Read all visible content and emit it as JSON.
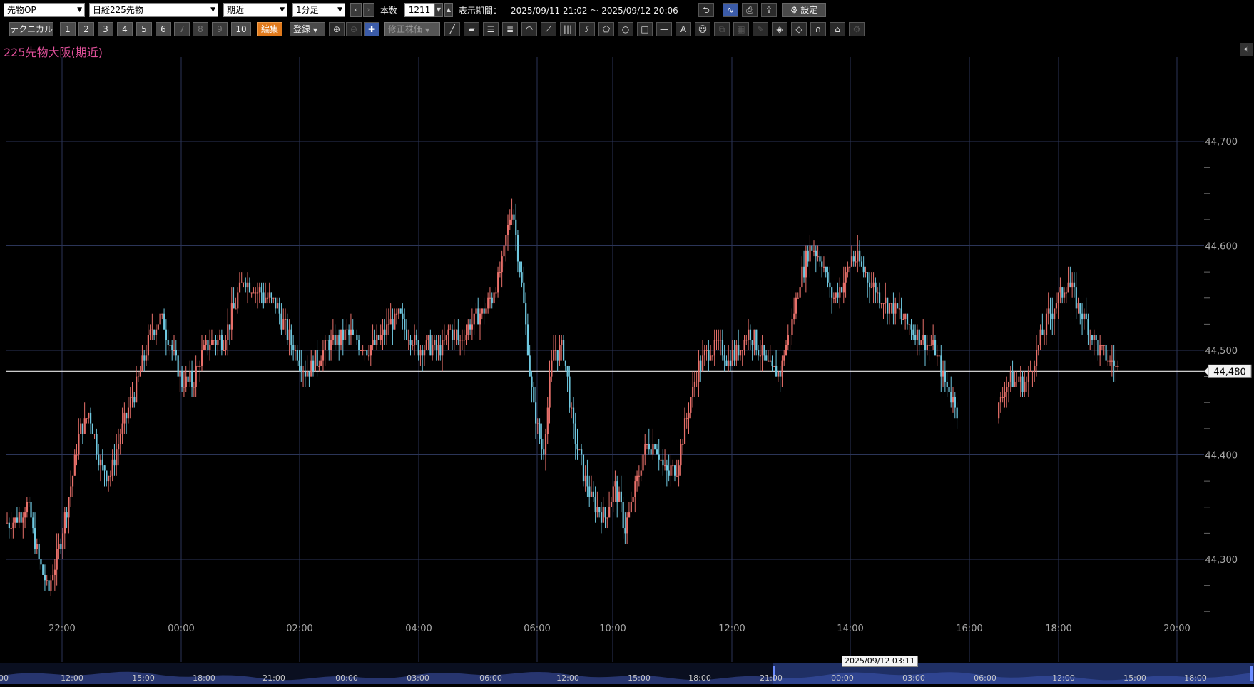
{
  "toolbar": {
    "category_select": "先物OP",
    "symbol_select": "日経225先物",
    "contract_select": "期近",
    "interval_select": "1分足",
    "prev_label": "‹",
    "next_label": "›",
    "count_label": "本数",
    "count_value": "1211",
    "period_label": "表示期間：",
    "period_value": "2025/09/11 21:02 ～ 2025/09/12 20:06",
    "settings_label": "設定"
  },
  "toolbar2": {
    "technical_label": "テクニカル",
    "preset_buttons": [
      "1",
      "2",
      "3",
      "4",
      "5",
      "6",
      "7",
      "8",
      "9",
      "10"
    ],
    "edit_label": "編集",
    "register_label": "登録",
    "adjust_label": "修正株価"
  },
  "chart_title": "225先物大阪(期近)",
  "price_tag": "44,480",
  "navigator_tooltip": "2025/09/12 03:11",
  "colors": {
    "up": "#e8706a",
    "down": "#6fc8e0",
    "grid": "#2b3558",
    "text": "#a8a8a8",
    "title": "#e0509a"
  },
  "chart_data": {
    "type": "candlestick",
    "y_ticks": [
      "44,700",
      "44,600",
      "44,500",
      "44,400",
      "44,300"
    ],
    "y_tick_values": [
      44700,
      44600,
      44500,
      44400,
      44300
    ],
    "x_ticks": [
      "22:00",
      "00:00",
      "02:00",
      "04:00",
      "06:00",
      "10:00",
      "12:00",
      "14:00",
      "16:00",
      "18:00",
      "20:00"
    ],
    "last_price": 44480,
    "navigator_labels": [
      "00",
      "12:00",
      "15:00",
      "18:00",
      "21:00",
      "00:00",
      "03:00",
      "06:00",
      "12:00",
      "15:00",
      "18:00",
      "21:00",
      "00:00",
      "03:00",
      "06:00",
      "12:00",
      "15:00",
      "18:00"
    ],
    "path": [
      [
        44335,
        44345
      ],
      [
        44340,
        44360
      ],
      [
        44355,
        44330
      ],
      [
        44300,
        44250
      ],
      [
        44270,
        44300
      ],
      [
        44310,
        44340
      ],
      [
        44360,
        44400
      ],
      [
        44420,
        44450
      ],
      [
        44440,
        44400
      ],
      [
        44390,
        44370
      ],
      [
        44380,
        44410
      ],
      [
        44420,
        44440
      ],
      [
        44450,
        44470
      ],
      [
        44480,
        44500
      ],
      [
        44520,
        44540
      ],
      [
        44530,
        44520
      ],
      [
        44500,
        44480
      ],
      [
        44470,
        44460
      ],
      [
        44470,
        44490
      ],
      [
        44500,
        44520
      ],
      [
        44510,
        44500
      ],
      [
        44510,
        44530
      ],
      [
        44540,
        44560
      ],
      [
        44570,
        44560
      ],
      [
        44560,
        44550
      ],
      [
        44550,
        44540
      ],
      [
        44545,
        44535
      ],
      [
        44520,
        44505
      ],
      [
        44500,
        44490
      ],
      [
        44480,
        44475
      ],
      [
        44490,
        44500
      ],
      [
        44505,
        44515
      ],
      [
        44510,
        44515
      ],
      [
        44515,
        44505
      ],
      [
        44510,
        44500
      ],
      [
        44500,
        44505
      ],
      [
        44510,
        44520
      ],
      [
        44525,
        44535
      ],
      [
        44530,
        44520
      ],
      [
        44515,
        44500
      ],
      [
        44500,
        44510
      ],
      [
        44505,
        44500
      ],
      [
        44500,
        44510
      ],
      [
        44520,
        44515
      ],
      [
        44510,
        44520
      ],
      [
        44525,
        44530
      ],
      [
        44535,
        44545
      ],
      [
        44550,
        44560
      ],
      [
        44580,
        44620
      ],
      [
        44640,
        44600
      ],
      [
        44560,
        44480
      ],
      [
        44450,
        44420
      ],
      [
        44400,
        44440
      ],
      [
        44500,
        44540
      ],
      [
        44500,
        44440
      ],
      [
        44420,
        44390
      ],
      [
        44380,
        44360
      ],
      [
        44350,
        44340
      ],
      [
        44340,
        44360
      ],
      [
        44370,
        44340
      ],
      [
        44330,
        44350
      ],
      [
        44370,
        44390
      ],
      [
        44410,
        44420
      ],
      [
        44410,
        44390
      ],
      [
        44380,
        44370
      ],
      [
        44390,
        44420
      ],
      [
        44440,
        44460
      ],
      [
        44480,
        44490
      ],
      [
        44500,
        44510
      ],
      [
        44505,
        44495
      ],
      [
        44490,
        44500
      ],
      [
        44500,
        44510
      ],
      [
        44520,
        44510
      ],
      [
        44500,
        44490
      ],
      [
        44480,
        44470
      ],
      [
        44480,
        44500
      ],
      [
        44520,
        44550
      ],
      [
        44570,
        44590
      ],
      [
        44600,
        44580
      ],
      [
        44590,
        44560
      ],
      [
        44550,
        44540
      ],
      [
        44560,
        44580
      ],
      [
        44590,
        44600
      ],
      [
        44580,
        44550
      ],
      [
        44560,
        44540
      ],
      [
        44550,
        44530
      ],
      [
        44540,
        44520
      ],
      [
        44530,
        44510
      ],
      [
        44520,
        44500
      ],
      [
        44510,
        44515
      ],
      [
        44500,
        44480
      ],
      [
        44470,
        44460
      ],
      [
        44450,
        44430
      ],
      [
        44420,
        44400
      ],
      [
        44390,
        44380
      ],
      [
        44400,
        44430
      ],
      [
        44440,
        44460
      ],
      [
        44470,
        44480
      ],
      [
        44470,
        44460
      ],
      [
        44470,
        44490
      ],
      [
        44500,
        44520
      ],
      [
        44530,
        44545
      ],
      [
        44550,
        44560
      ],
      [
        44565,
        44550
      ],
      [
        44540,
        44530
      ],
      [
        44520,
        44510
      ],
      [
        44500,
        44490
      ],
      [
        44490,
        44485
      ],
      [
        44480,
        44480
      ]
    ]
  }
}
